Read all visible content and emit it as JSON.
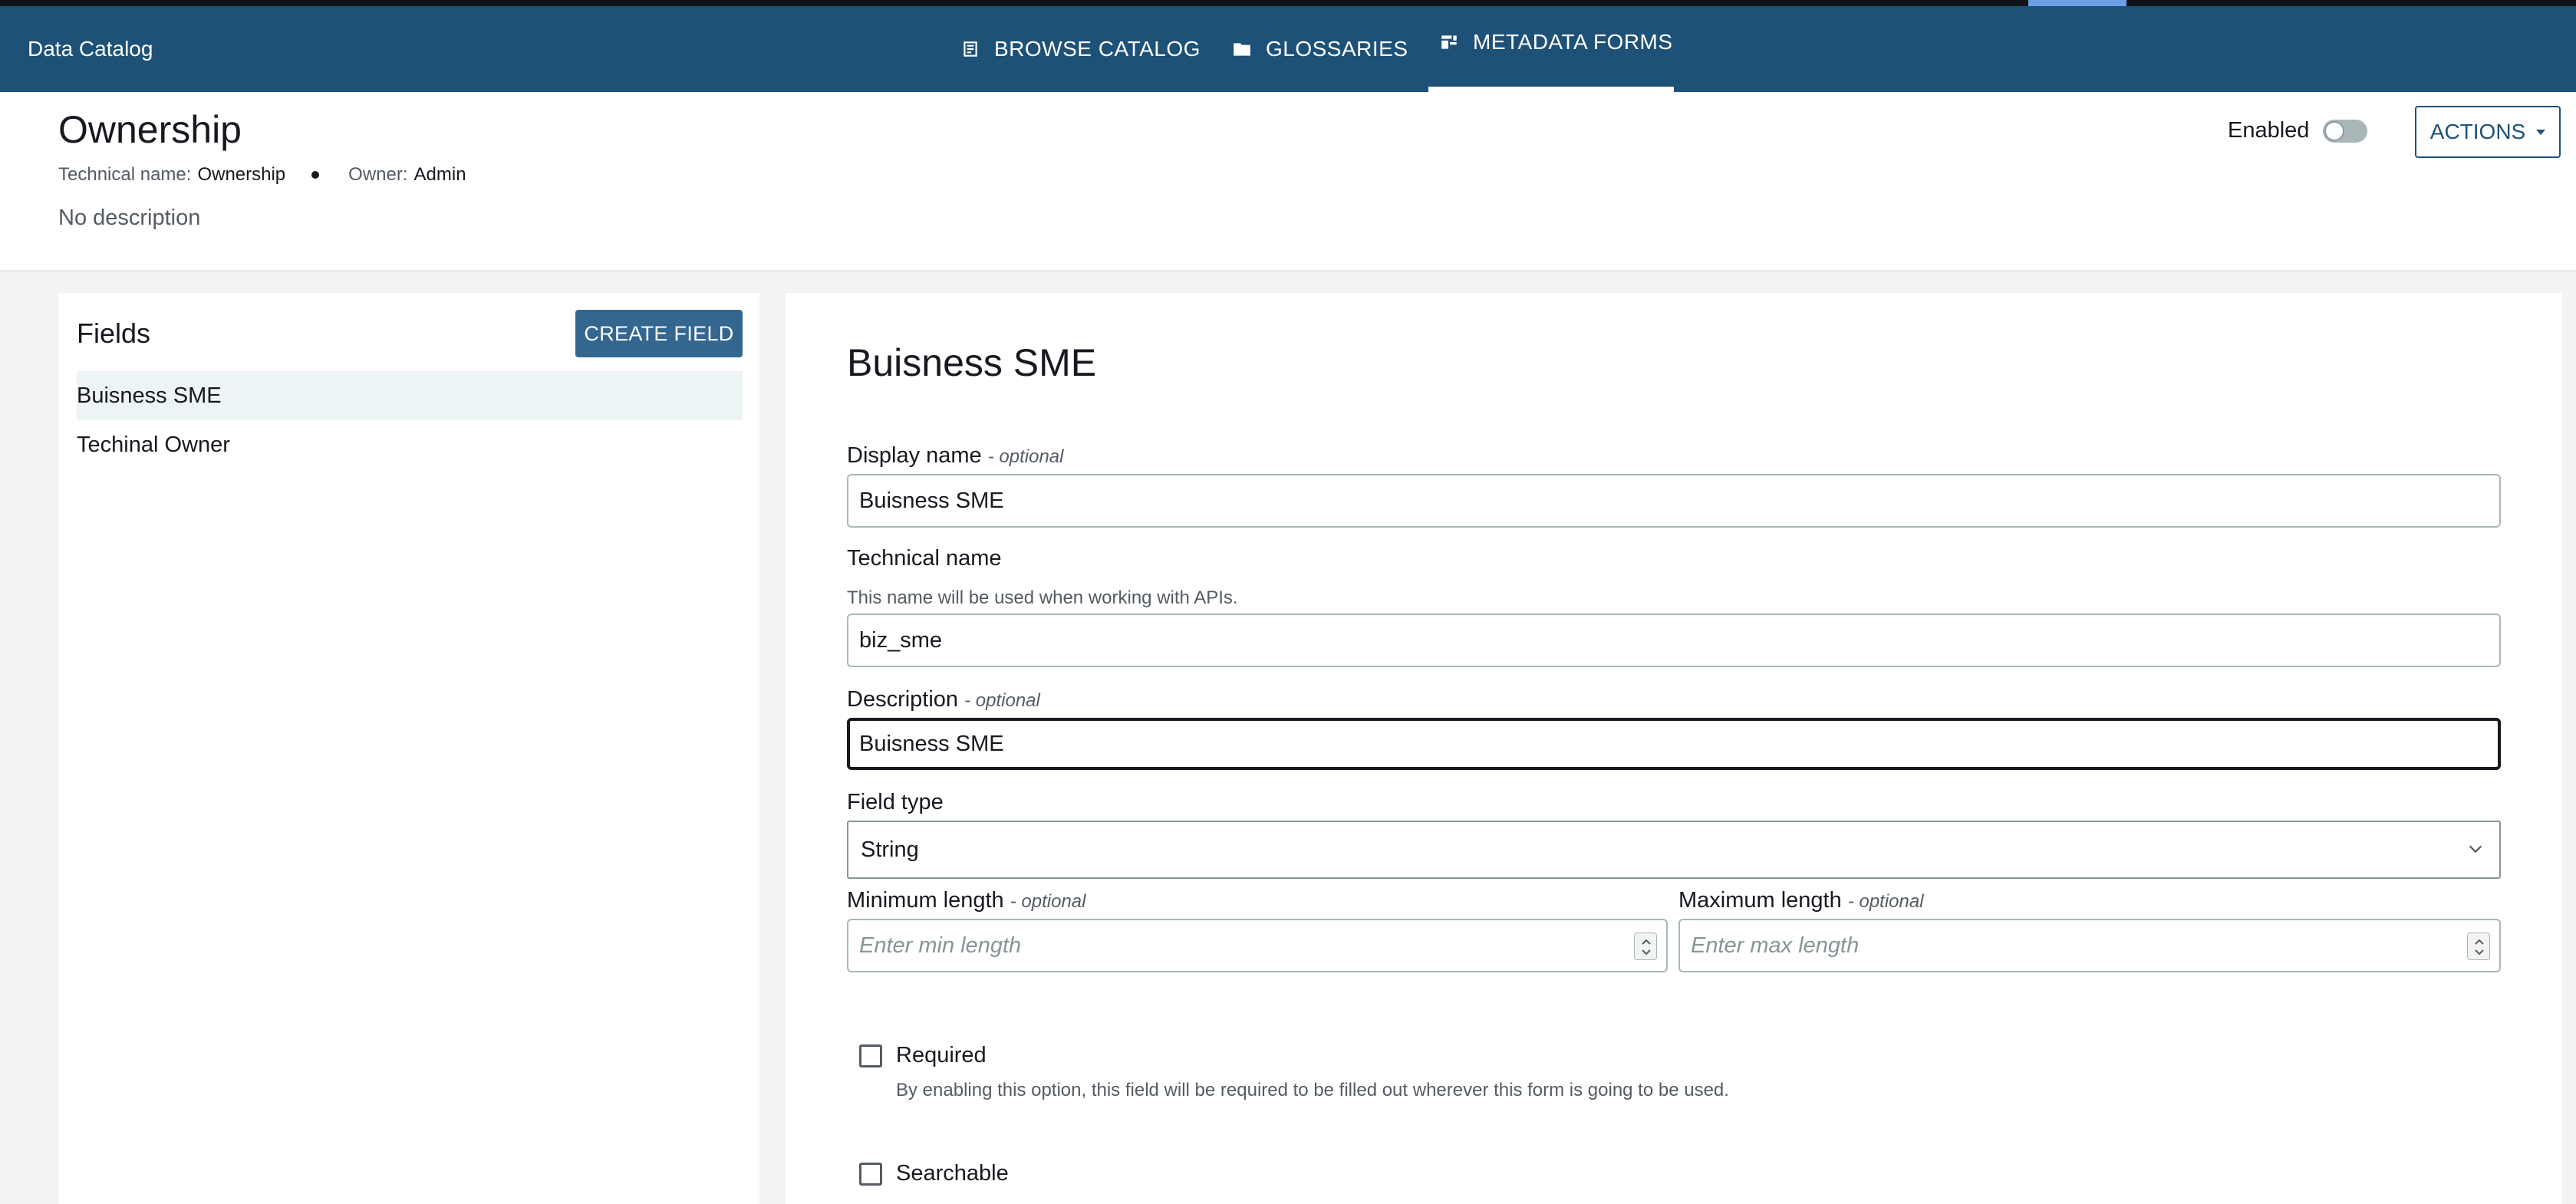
{
  "app": {
    "title": "Data Catalog"
  },
  "nav": {
    "tabs": [
      {
        "label": "BROWSE CATALOG",
        "icon": "catalog-icon",
        "active": false
      },
      {
        "label": "GLOSSARIES",
        "icon": "folder-icon",
        "active": false
      },
      {
        "label": "METADATA FORMS",
        "icon": "forms-icon",
        "active": true
      }
    ]
  },
  "form": {
    "title": "Ownership",
    "technical_name_label": "Technical name:",
    "technical_name": "Ownership",
    "owner_label": "Owner:",
    "owner": "Admin",
    "description": "No description",
    "enabled_label": "Enabled",
    "enabled": false,
    "actions_label": "ACTIONS"
  },
  "fields_panel": {
    "title": "Fields",
    "create_label": "CREATE FIELD",
    "items": [
      {
        "label": "Buisness SME",
        "selected": true
      },
      {
        "label": "Techinal Owner",
        "selected": false
      }
    ]
  },
  "editor": {
    "title": "Buisness SME",
    "optional_suffix": "- optional",
    "display_name": {
      "label": "Display name",
      "value": "Buisness SME"
    },
    "technical_name": {
      "label": "Technical name",
      "hint": "This name will be used when working with APIs.",
      "value": "biz_sme"
    },
    "description": {
      "label": "Description",
      "value": "Buisness SME"
    },
    "field_type": {
      "label": "Field type",
      "value": "String"
    },
    "min_length": {
      "label": "Minimum length",
      "placeholder": "Enter min length"
    },
    "max_length": {
      "label": "Maximum length",
      "placeholder": "Enter max length"
    },
    "required": {
      "label": "Required",
      "hint": "By enabling this option, this field will be required to be filled out wherever this form is going to be used.",
      "checked": false
    },
    "searchable": {
      "label": "Searchable",
      "checked": false
    }
  },
  "colors": {
    "nav_bg": "#1e5177",
    "primary_button": "#33678f",
    "selected_row": "#edf4f5"
  }
}
